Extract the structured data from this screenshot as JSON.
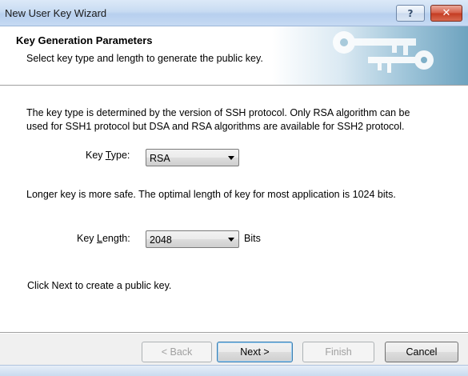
{
  "window": {
    "title": "New User Key Wizard",
    "help_glyph": "?",
    "close_glyph": "✕"
  },
  "header": {
    "title": "Key Generation Parameters",
    "subtitle": "Select key type and length to generate the public key.",
    "art_icon": "keys-icon"
  },
  "body": {
    "intro_line1": "The key type is determined by the version of SSH protocol. Only RSA algorithm can be",
    "intro_line2": "used for SSH1 protocol but DSA and RSA algorithms are available for SSH2 protocol.",
    "key_type": {
      "label_pre": "Key ",
      "label_mnemonic": "T",
      "label_post": "ype:",
      "value": "RSA"
    },
    "length_note": "Longer key is more safe. The optimal length of key for most application is 1024 bits.",
    "key_length": {
      "label_pre": "Key ",
      "label_mnemonic": "L",
      "label_post": "ength:",
      "value": "2048",
      "unit": "Bits"
    },
    "next_note": "Click Next to create a public key."
  },
  "buttons": {
    "back": "< Back",
    "next": "Next >",
    "finish": "Finish",
    "cancel": "Cancel"
  },
  "colors": {
    "title_bar": "#c8dbf2",
    "close_button": "#c43b22",
    "banner_art": "#6ea3bf"
  }
}
